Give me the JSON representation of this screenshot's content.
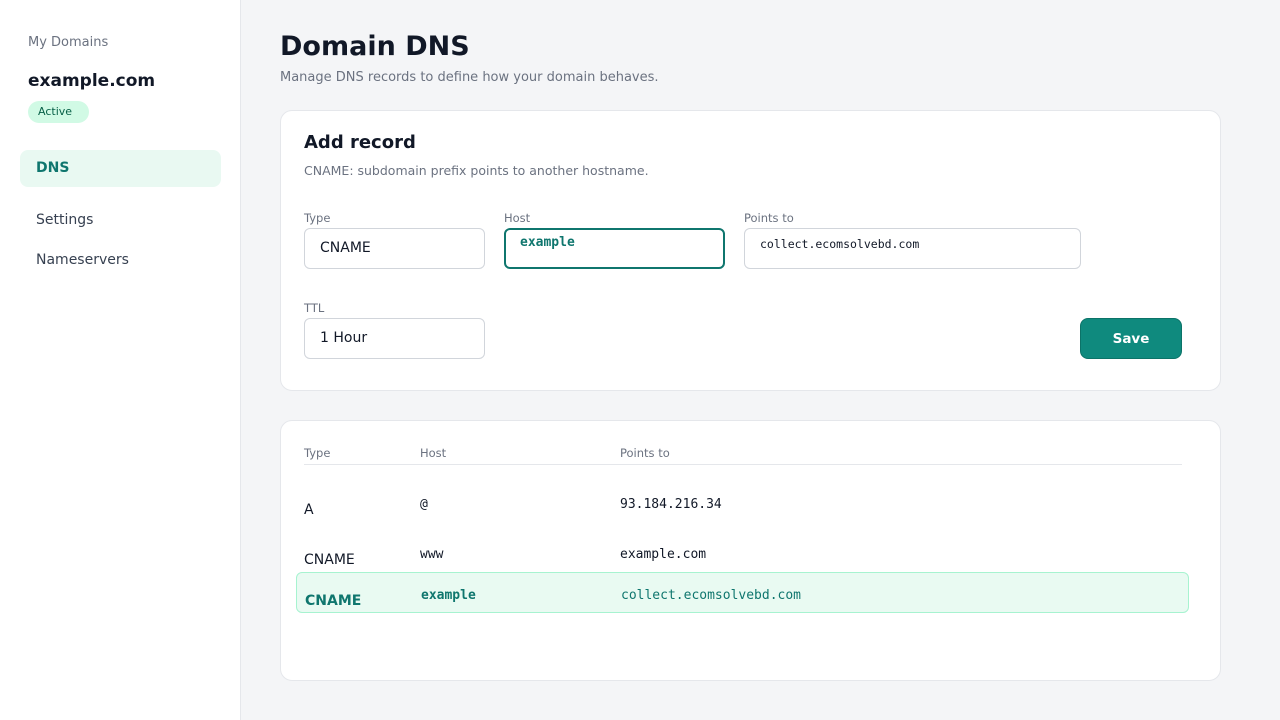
{
  "sidebar": {
    "breadcrumb": "My Domains",
    "domain": "example.com",
    "status": "Active",
    "nav": [
      {
        "label": "DNS"
      },
      {
        "label": "Settings"
      },
      {
        "label": "Nameservers"
      }
    ]
  },
  "header": {
    "title": "Domain DNS",
    "subtitle": "Manage DNS records to define how your domain behaves."
  },
  "add_record": {
    "title": "Add record",
    "hint": "CNAME: subdomain prefix points to another hostname.",
    "type_label": "Type",
    "type_value": "CNAME",
    "host_label": "Host",
    "host_value": "example",
    "points_label": "Points to",
    "points_value": "collect.ecomsolvebd.com",
    "ttl_label": "TTL",
    "ttl_value": "1 Hour",
    "save_label": "Save"
  },
  "records": {
    "columns": [
      "Type",
      "Host",
      "Points to"
    ],
    "rows": [
      {
        "type": "A",
        "host": "@",
        "points": "93.184.216.34"
      },
      {
        "type": "CNAME",
        "host": "www",
        "points": "example.com"
      },
      {
        "type": "CNAME",
        "host": "example",
        "points": "collect.ecomsolvebd.com"
      }
    ]
  },
  "colors": {
    "accent": "#0f8a7e",
    "accent_text": "#0f766e",
    "active_bg": "#e9f9f2",
    "badge_bg": "#d1fae5"
  }
}
